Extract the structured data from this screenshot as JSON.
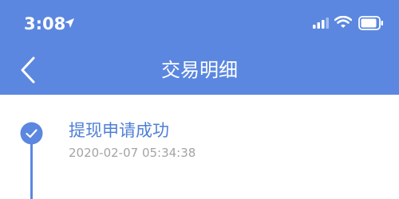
{
  "status_bar": {
    "time": "3:08",
    "icons": [
      "location-arrow-icon",
      "cellular-signal-icon",
      "wifi-icon",
      "battery-icon"
    ]
  },
  "nav": {
    "back_icon": "chevron-left-icon",
    "title": "交易明细"
  },
  "timeline": {
    "events": [
      {
        "status_icon": "check-circle-icon",
        "title": "提现申请成功",
        "time": "2020-02-07 05:34:38"
      }
    ]
  },
  "colors": {
    "header_bg": "#5b87e0",
    "accent": "#4f7fd6",
    "muted_text": "#a4a4a4",
    "background": "#ffffff"
  }
}
